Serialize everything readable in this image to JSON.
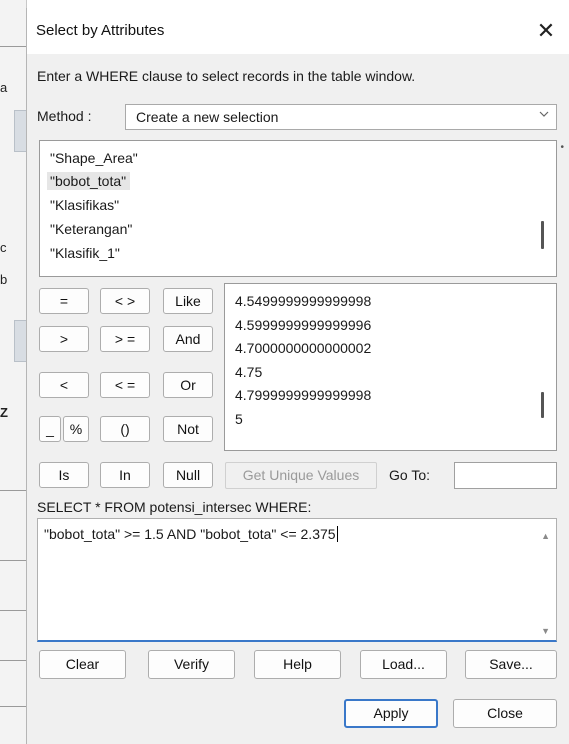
{
  "background_app": {
    "edge_chars": [
      "a",
      "c",
      "b",
      "Z"
    ]
  },
  "dialog": {
    "title": "Select by Attributes",
    "close_glyph": "✕",
    "instruction": "Enter a WHERE clause to select records in the table window.",
    "method_label": "Method :",
    "method_value": "Create a new selection",
    "fields": [
      "\"Shape_Area\"",
      "\"bobot_tota\"",
      "\"Klasifikas\"",
      "\"Keterangan\"",
      "\"Klasifik_1\""
    ],
    "selected_field": "\"bobot_tota\"",
    "operators": {
      "eq": "=",
      "ne": "< >",
      "like": "Like",
      "gt": ">",
      "ge": "> =",
      "and": "And",
      "lt": "<",
      "le": "< =",
      "or": "Or",
      "underscore": "_",
      "percent": "%",
      "parens": "()",
      "not": "Not",
      "is": "Is",
      "in": "In",
      "null": "Null"
    },
    "values": [
      "4.5499999999999998",
      "4.5999999999999996",
      "4.7000000000000002",
      "4.75",
      "4.7999999999999998",
      "5"
    ],
    "get_unique_values": "Get Unique Values",
    "goto_label": "Go To:",
    "goto_value": "",
    "sql_prefix": "SELECT * FROM potensi_intersec WHERE:",
    "sql_expression": "\"bobot_tota\" >= 1.5 AND \"bobot_tota\" <= 2.375",
    "buttons": {
      "clear": "Clear",
      "verify": "Verify",
      "help": "Help",
      "load": "Load...",
      "save": "Save...",
      "apply": "Apply",
      "close": "Close"
    }
  },
  "colors": {
    "accent": "#3a78c9",
    "dialog_bg": "#f0f0f0"
  }
}
